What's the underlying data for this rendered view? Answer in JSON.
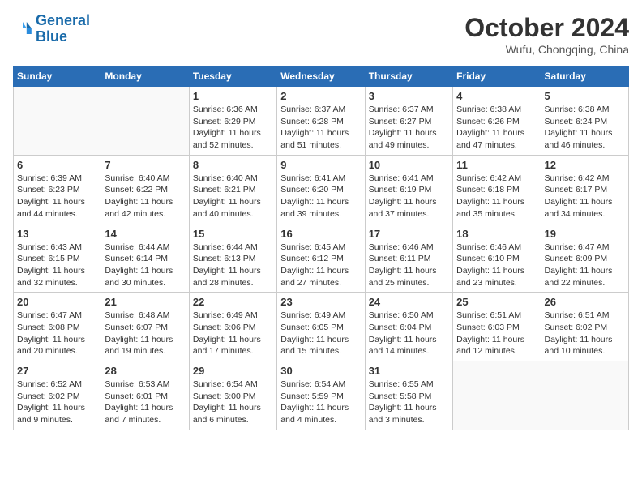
{
  "header": {
    "logo_line1": "General",
    "logo_line2": "Blue",
    "month": "October 2024",
    "location": "Wufu, Chongqing, China"
  },
  "weekdays": [
    "Sunday",
    "Monday",
    "Tuesday",
    "Wednesday",
    "Thursday",
    "Friday",
    "Saturday"
  ],
  "weeks": [
    [
      {
        "day": "",
        "info": ""
      },
      {
        "day": "",
        "info": ""
      },
      {
        "day": "1",
        "info": "Sunrise: 6:36 AM\nSunset: 6:29 PM\nDaylight: 11 hours and 52 minutes."
      },
      {
        "day": "2",
        "info": "Sunrise: 6:37 AM\nSunset: 6:28 PM\nDaylight: 11 hours and 51 minutes."
      },
      {
        "day": "3",
        "info": "Sunrise: 6:37 AM\nSunset: 6:27 PM\nDaylight: 11 hours and 49 minutes."
      },
      {
        "day": "4",
        "info": "Sunrise: 6:38 AM\nSunset: 6:26 PM\nDaylight: 11 hours and 47 minutes."
      },
      {
        "day": "5",
        "info": "Sunrise: 6:38 AM\nSunset: 6:24 PM\nDaylight: 11 hours and 46 minutes."
      }
    ],
    [
      {
        "day": "6",
        "info": "Sunrise: 6:39 AM\nSunset: 6:23 PM\nDaylight: 11 hours and 44 minutes."
      },
      {
        "day": "7",
        "info": "Sunrise: 6:40 AM\nSunset: 6:22 PM\nDaylight: 11 hours and 42 minutes."
      },
      {
        "day": "8",
        "info": "Sunrise: 6:40 AM\nSunset: 6:21 PM\nDaylight: 11 hours and 40 minutes."
      },
      {
        "day": "9",
        "info": "Sunrise: 6:41 AM\nSunset: 6:20 PM\nDaylight: 11 hours and 39 minutes."
      },
      {
        "day": "10",
        "info": "Sunrise: 6:41 AM\nSunset: 6:19 PM\nDaylight: 11 hours and 37 minutes."
      },
      {
        "day": "11",
        "info": "Sunrise: 6:42 AM\nSunset: 6:18 PM\nDaylight: 11 hours and 35 minutes."
      },
      {
        "day": "12",
        "info": "Sunrise: 6:42 AM\nSunset: 6:17 PM\nDaylight: 11 hours and 34 minutes."
      }
    ],
    [
      {
        "day": "13",
        "info": "Sunrise: 6:43 AM\nSunset: 6:15 PM\nDaylight: 11 hours and 32 minutes."
      },
      {
        "day": "14",
        "info": "Sunrise: 6:44 AM\nSunset: 6:14 PM\nDaylight: 11 hours and 30 minutes."
      },
      {
        "day": "15",
        "info": "Sunrise: 6:44 AM\nSunset: 6:13 PM\nDaylight: 11 hours and 28 minutes."
      },
      {
        "day": "16",
        "info": "Sunrise: 6:45 AM\nSunset: 6:12 PM\nDaylight: 11 hours and 27 minutes."
      },
      {
        "day": "17",
        "info": "Sunrise: 6:46 AM\nSunset: 6:11 PM\nDaylight: 11 hours and 25 minutes."
      },
      {
        "day": "18",
        "info": "Sunrise: 6:46 AM\nSunset: 6:10 PM\nDaylight: 11 hours and 23 minutes."
      },
      {
        "day": "19",
        "info": "Sunrise: 6:47 AM\nSunset: 6:09 PM\nDaylight: 11 hours and 22 minutes."
      }
    ],
    [
      {
        "day": "20",
        "info": "Sunrise: 6:47 AM\nSunset: 6:08 PM\nDaylight: 11 hours and 20 minutes."
      },
      {
        "day": "21",
        "info": "Sunrise: 6:48 AM\nSunset: 6:07 PM\nDaylight: 11 hours and 19 minutes."
      },
      {
        "day": "22",
        "info": "Sunrise: 6:49 AM\nSunset: 6:06 PM\nDaylight: 11 hours and 17 minutes."
      },
      {
        "day": "23",
        "info": "Sunrise: 6:49 AM\nSunset: 6:05 PM\nDaylight: 11 hours and 15 minutes."
      },
      {
        "day": "24",
        "info": "Sunrise: 6:50 AM\nSunset: 6:04 PM\nDaylight: 11 hours and 14 minutes."
      },
      {
        "day": "25",
        "info": "Sunrise: 6:51 AM\nSunset: 6:03 PM\nDaylight: 11 hours and 12 minutes."
      },
      {
        "day": "26",
        "info": "Sunrise: 6:51 AM\nSunset: 6:02 PM\nDaylight: 11 hours and 10 minutes."
      }
    ],
    [
      {
        "day": "27",
        "info": "Sunrise: 6:52 AM\nSunset: 6:02 PM\nDaylight: 11 hours and 9 minutes."
      },
      {
        "day": "28",
        "info": "Sunrise: 6:53 AM\nSunset: 6:01 PM\nDaylight: 11 hours and 7 minutes."
      },
      {
        "day": "29",
        "info": "Sunrise: 6:54 AM\nSunset: 6:00 PM\nDaylight: 11 hours and 6 minutes."
      },
      {
        "day": "30",
        "info": "Sunrise: 6:54 AM\nSunset: 5:59 PM\nDaylight: 11 hours and 4 minutes."
      },
      {
        "day": "31",
        "info": "Sunrise: 6:55 AM\nSunset: 5:58 PM\nDaylight: 11 hours and 3 minutes."
      },
      {
        "day": "",
        "info": ""
      },
      {
        "day": "",
        "info": ""
      }
    ]
  ]
}
